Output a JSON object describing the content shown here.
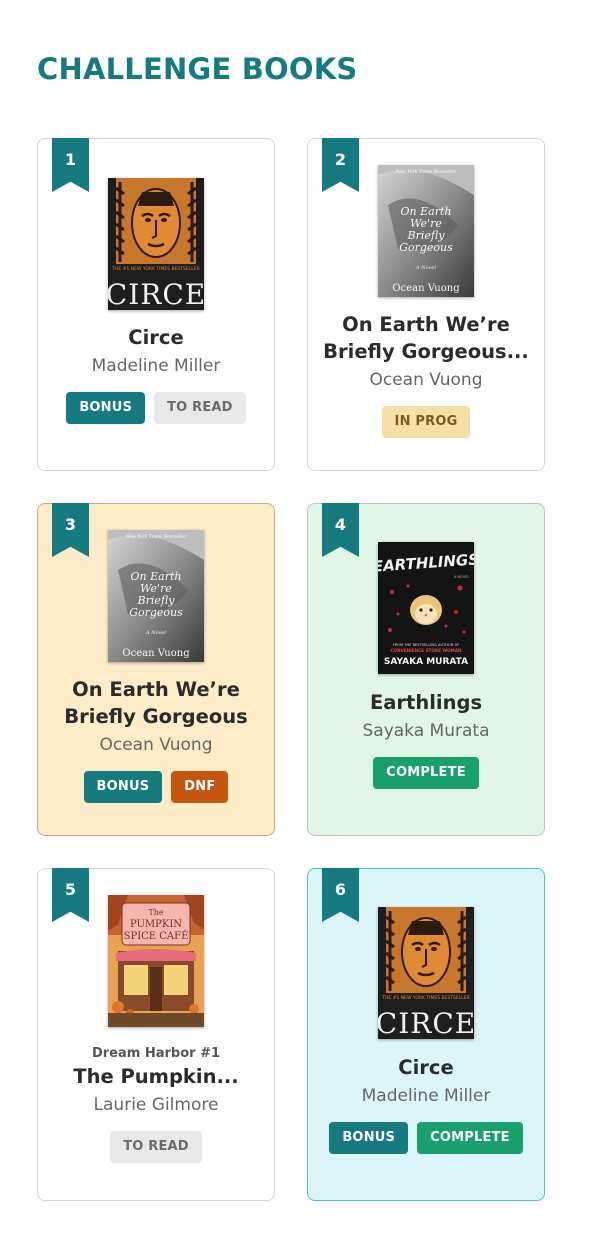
{
  "page": {
    "title": "CHALLENGE BOOKS"
  },
  "books": [
    {
      "number": "1",
      "cover": {
        "icon": "circe-cover-icon",
        "label": "CIRCE",
        "banner": "THE #1 NEW YORK TIMES BESTSELLER"
      },
      "title": "Circe",
      "author": "Madeline Miller",
      "badges": [
        "BONUS",
        "TO READ"
      ]
    },
    {
      "number": "2",
      "cover": {
        "icon": "on-earth-cover-icon",
        "top": "New York Times Bestseller",
        "label": "On Earth We're Briefly Gorgeous",
        "sub": "A Novel",
        "author": "Ocean Vuong"
      },
      "title": "On Earth We’re Briefly Gorgeous...",
      "author": "Ocean Vuong",
      "badges": [
        "IN PROG"
      ]
    },
    {
      "number": "3",
      "cover": {
        "icon": "on-earth-cover-icon",
        "top": "New York Times Bestseller",
        "label": "On Earth We're Briefly Gorgeous",
        "sub": "A Novel",
        "author": "Ocean Vuong"
      },
      "title": "On Earth We’re Briefly Gorgeous",
      "author": "Ocean Vuong",
      "badges": [
        "BONUS",
        "DNF"
      ]
    },
    {
      "number": "4",
      "cover": {
        "icon": "earthlings-cover-icon",
        "label": "EARTHLINGS",
        "sub": "CONVENIENCE STORE WOMAN",
        "author": "SAYAKA MURATA"
      },
      "title": "Earthlings",
      "author": "Sayaka Murata",
      "badges": [
        "COMPLETE"
      ]
    },
    {
      "number": "5",
      "cover": {
        "icon": "pumpkin-spice-cafe-cover-icon",
        "label": "The Pumpkin Spice Café"
      },
      "series": "Dream Harbor #1",
      "title": "The Pumpkin...",
      "author": "Laurie Gilmore",
      "badges": [
        "TO READ"
      ]
    },
    {
      "number": "6",
      "cover": {
        "icon": "circe-cover-icon",
        "label": "CIRCE",
        "banner": "THE #1 NEW YORK TIMES BESTSELLER"
      },
      "title": "Circe",
      "author": "Madeline Miller",
      "badges": [
        "BONUS",
        "COMPLETE"
      ]
    }
  ],
  "colors": {
    "accent": "#167b80",
    "bonus": "#167b80",
    "to_read": "#e8e8e8",
    "in_prog": "#f6dfa7",
    "dnf": "#c5560f",
    "complete": "#19a06d",
    "card_yellow": "#fdecc8",
    "card_green": "#e1f6e6",
    "card_blue": "#dcf5f8"
  }
}
